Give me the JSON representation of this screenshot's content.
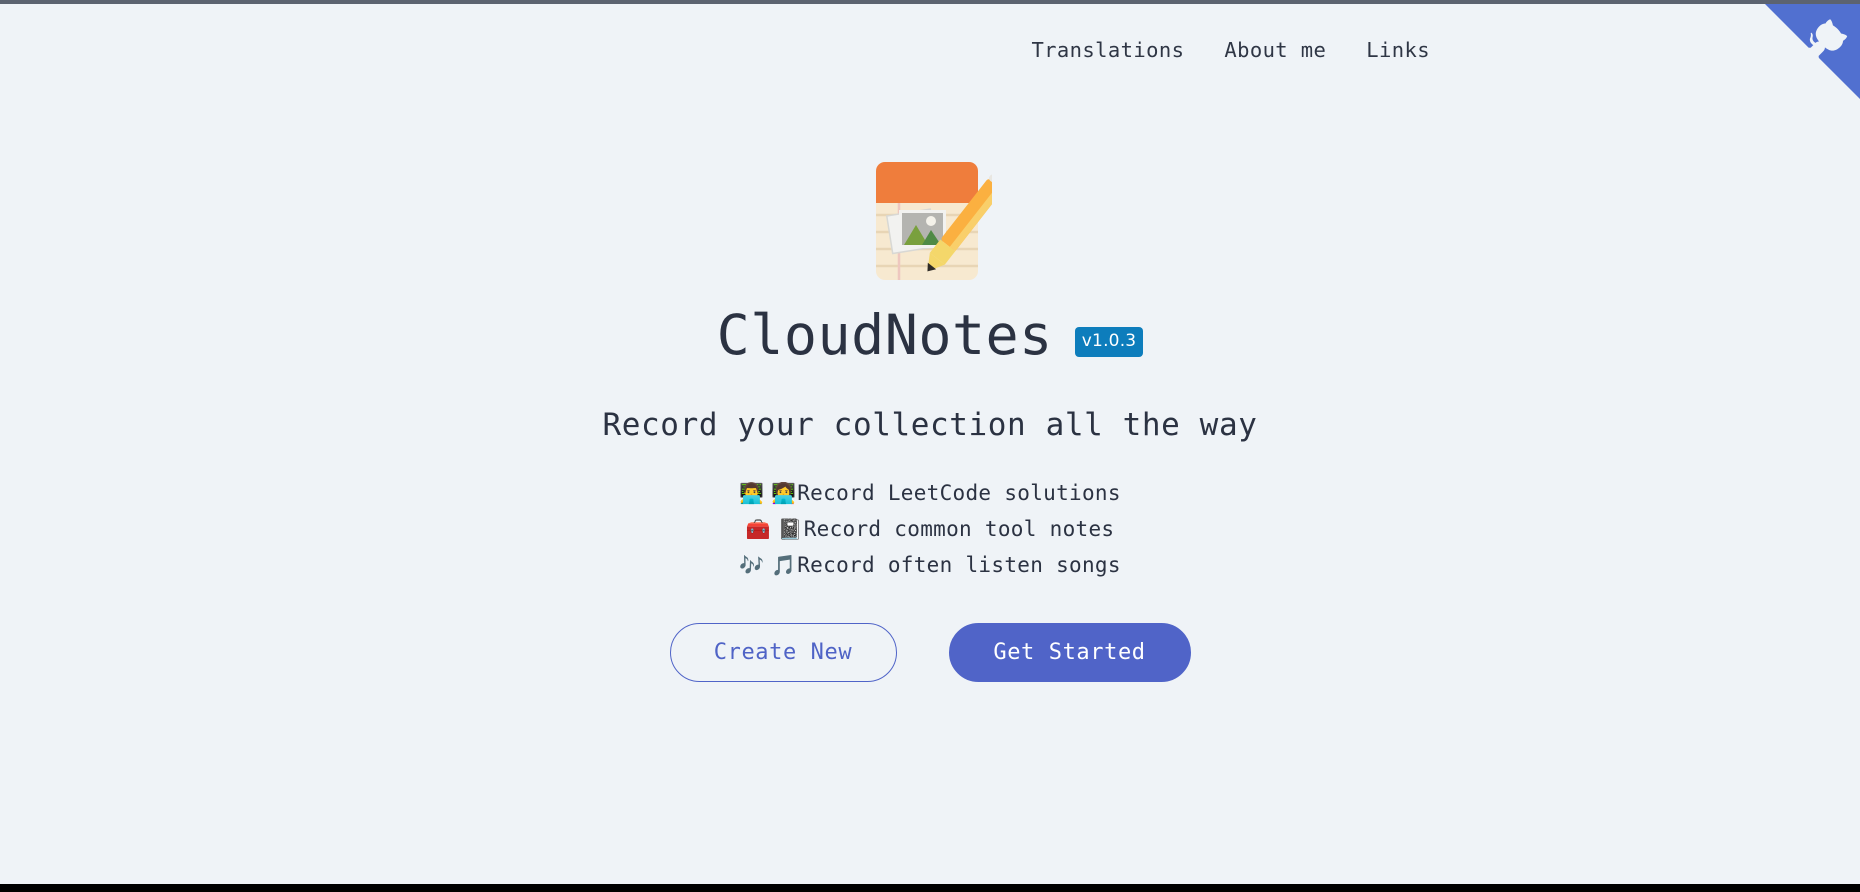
{
  "window": {
    "top_edge_color": "#5c6370",
    "bottom_edge_color": "#000000",
    "background_color": "#eff3f7"
  },
  "nav": {
    "items": [
      {
        "label": "Translations",
        "name": "nav-link-translations"
      },
      {
        "label": "About me",
        "name": "nav-link-about-me"
      },
      {
        "label": "Links",
        "name": "nav-link-links"
      }
    ],
    "github_corner": {
      "icon": "github-octocat-icon",
      "ribbon_color": "#5170d0",
      "octocat_color": "#eff3f7"
    }
  },
  "hero": {
    "logo_icon": "memo-notepad-pencil-icon",
    "title": "CloudNotes",
    "version_badge": {
      "label": "v1.0.3",
      "background_color": "#0d7dbc",
      "text_color": "#ffffff"
    },
    "tagline": "Record your collection all the way",
    "features": [
      {
        "emoji": "👨‍💻 👩‍💻",
        "emoji_name": "technologist-emoji",
        "text": "Record LeetCode solutions"
      },
      {
        "emoji": "🧰 📓",
        "emoji_name": "toolbox-notebook-emoji",
        "text": "Record common tool notes"
      },
      {
        "emoji": "🎶 🎵",
        "emoji_name": "music-notes-emoji",
        "text": "Record often listen songs"
      }
    ],
    "buttons": {
      "secondary": {
        "label": "Create New",
        "text_color": "#4f63c6",
        "border_color": "#5064c8"
      },
      "primary": {
        "label": "Get Started",
        "background_color": "#5064c8",
        "text_color": "#ffffff"
      }
    }
  },
  "colors": {
    "accent": "#5064c8",
    "text": "#2b3242",
    "background": "#eff3f7",
    "badge_blue": "#0d7dbc",
    "ribbon_blue": "#5170d0"
  }
}
